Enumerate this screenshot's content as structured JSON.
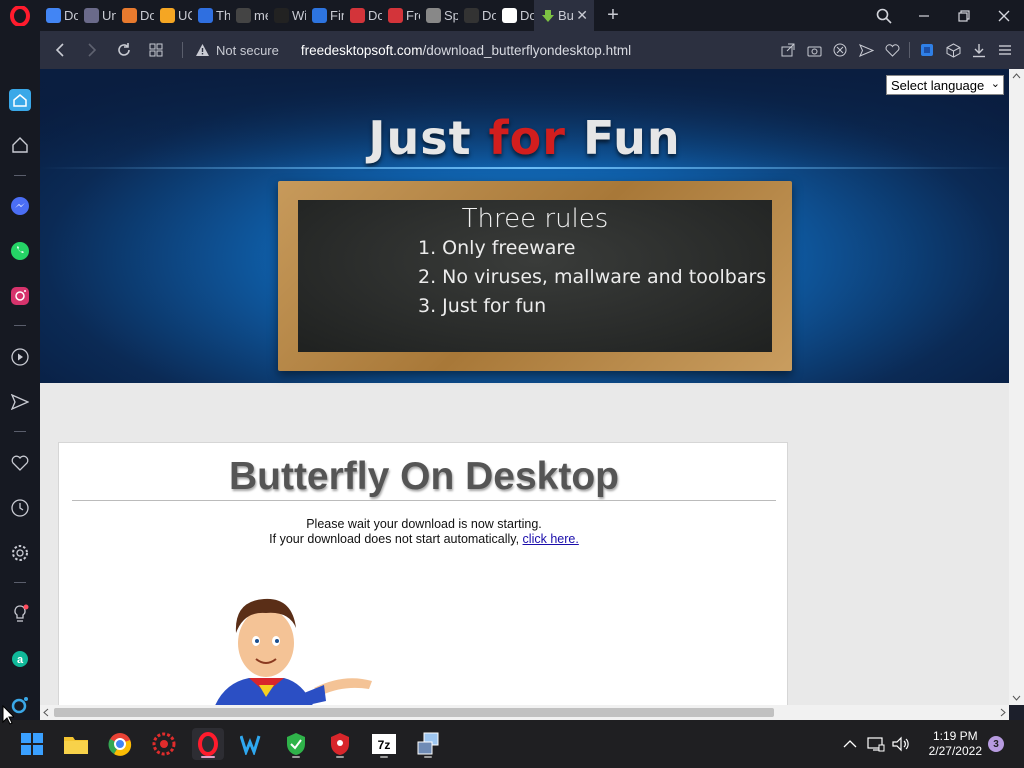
{
  "tabs": [
    {
      "label": "Dov",
      "icon": "google-icon",
      "color": "#4285f4"
    },
    {
      "label": "Unl",
      "icon": "vivaldi-icon",
      "color": "#6a6a8a"
    },
    {
      "label": "Dov",
      "icon": "softonic-icon",
      "color": "#e87a2e"
    },
    {
      "label": "UC",
      "icon": "uc-icon",
      "color": "#f5a623"
    },
    {
      "label": "The",
      "icon": "info-icon",
      "color": "#2f6fe0"
    },
    {
      "label": "me",
      "icon": "page-icon",
      "color": "#444"
    },
    {
      "label": "Wir",
      "icon": "wiki-icon",
      "color": "#222"
    },
    {
      "label": "Fire",
      "icon": "firefox-icon",
      "color": "#2d74e0"
    },
    {
      "label": "Dov",
      "icon": "redapp-icon",
      "color": "#d3343a"
    },
    {
      "label": "Frec",
      "icon": "shield-icon",
      "color": "#d3343a"
    },
    {
      "label": "Spe",
      "icon": "grid-icon",
      "color": "#888"
    },
    {
      "label": "Dov",
      "icon": "brave-icon",
      "color": "#333"
    },
    {
      "label": "Dov",
      "icon": "globe-icon",
      "color": "#fff"
    }
  ],
  "active_tab": {
    "label": "Bu",
    "icon": "download-icon",
    "color": "#7cc243"
  },
  "addressbar": {
    "security": "Not secure",
    "url_domain": "freedesktopsoft.com",
    "url_path": "/download_butterflyondesktop.html"
  },
  "page": {
    "language_select": "Select language",
    "hero_title_1": "Just ",
    "hero_title_2": "for",
    "hero_title_3": " Fun",
    "board_title": "Three rules",
    "rules": [
      "1. Only freeware",
      "2. No viruses, mallware and toolbars",
      "3. Just for fun"
    ],
    "heading": "Butterfly On Desktop",
    "msg_line1": "Please wait your download is now starting.",
    "msg_line2": "If your download does not start automatically, ",
    "msg_link": "click here."
  },
  "taskbar": {
    "time": "1:19 PM",
    "date": "2/27/2022",
    "notification_count": "3"
  }
}
